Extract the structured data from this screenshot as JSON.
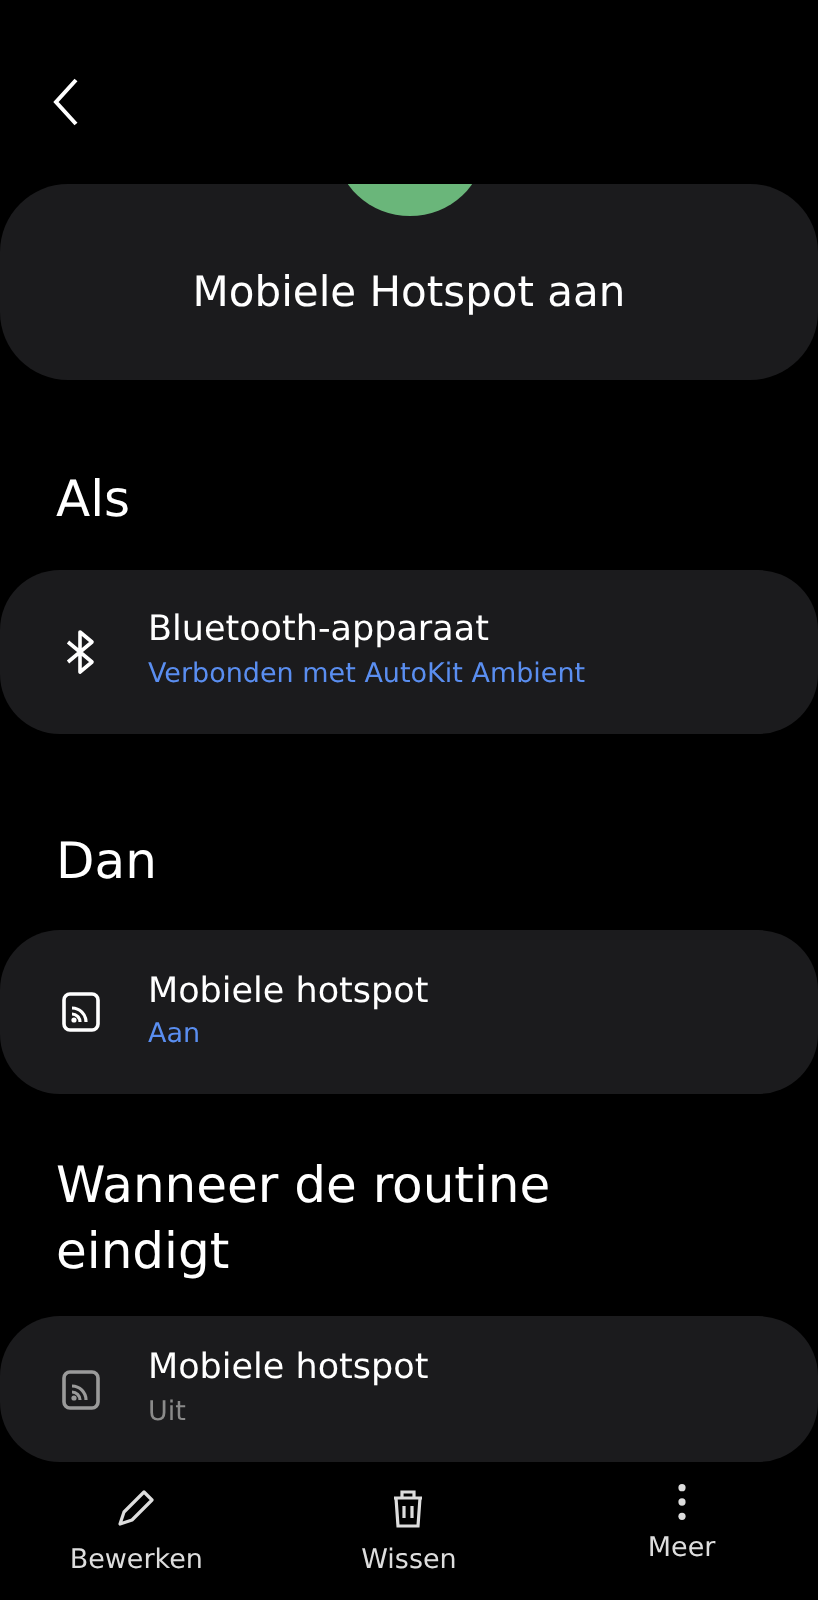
{
  "header": {
    "title": "Mobiele Hotspot aan"
  },
  "sections": [
    {
      "heading": "Als",
      "item": {
        "kind": "bluetooth",
        "title": "Bluetooth-apparaat",
        "subtitle": "Verbonden met AutoKit Ambient",
        "active": true
      }
    },
    {
      "heading": "Dan",
      "item": {
        "kind": "hotspot",
        "title": "Mobiele hotspot",
        "subtitle": "Aan",
        "active": true
      }
    },
    {
      "heading": "Wanneer de routine eindigt",
      "item": {
        "kind": "hotspot",
        "title": "Mobiele hotspot",
        "subtitle": "Uit",
        "active": false
      }
    }
  ],
  "actions": [
    {
      "kind": "edit",
      "label": "Bewerken"
    },
    {
      "kind": "delete",
      "label": "Wissen"
    },
    {
      "kind": "more",
      "label": "Meer"
    }
  ]
}
